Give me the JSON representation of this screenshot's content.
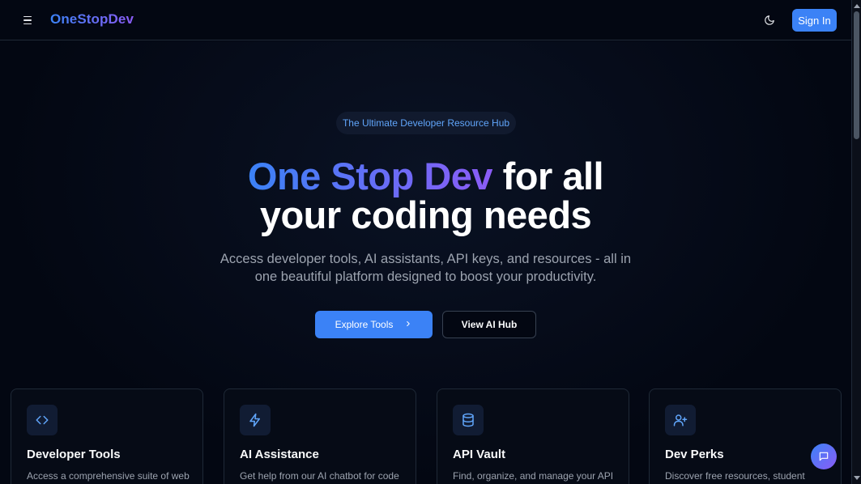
{
  "header": {
    "logo": "OneStopDev",
    "signin_label": "Sign In",
    "icons": {
      "menu": "menu-icon",
      "theme": "moon-icon"
    }
  },
  "hero": {
    "badge": "The Ultimate Developer Resource Hub",
    "headline_gradient": "One Stop Dev",
    "headline_rest": " for all",
    "headline_line2": "your coding needs",
    "subtext": "Access developer tools, AI assistants, API keys, and resources - all in one beautiful platform designed to boost your productivity.",
    "primary_button": "Explore Tools",
    "secondary_button": "View AI Hub"
  },
  "cards": [
    {
      "title": "Developer Tools",
      "desc": "Access a comprehensive suite of web",
      "icon": "code-icon"
    },
    {
      "title": "AI Assistance",
      "desc": "Get help from our AI chatbot for code",
      "icon": "lightning-icon"
    },
    {
      "title": "API Vault",
      "desc": "Find, organize, and manage your API",
      "icon": "database-icon"
    },
    {
      "title": "Dev Perks",
      "desc": "Discover free resources, student",
      "icon": "user-plus-icon"
    }
  ],
  "colors": {
    "background": "#030712",
    "accent_blue": "#3b82f6",
    "accent_purple": "#8b5cf6",
    "muted_text": "#9ca3af"
  }
}
